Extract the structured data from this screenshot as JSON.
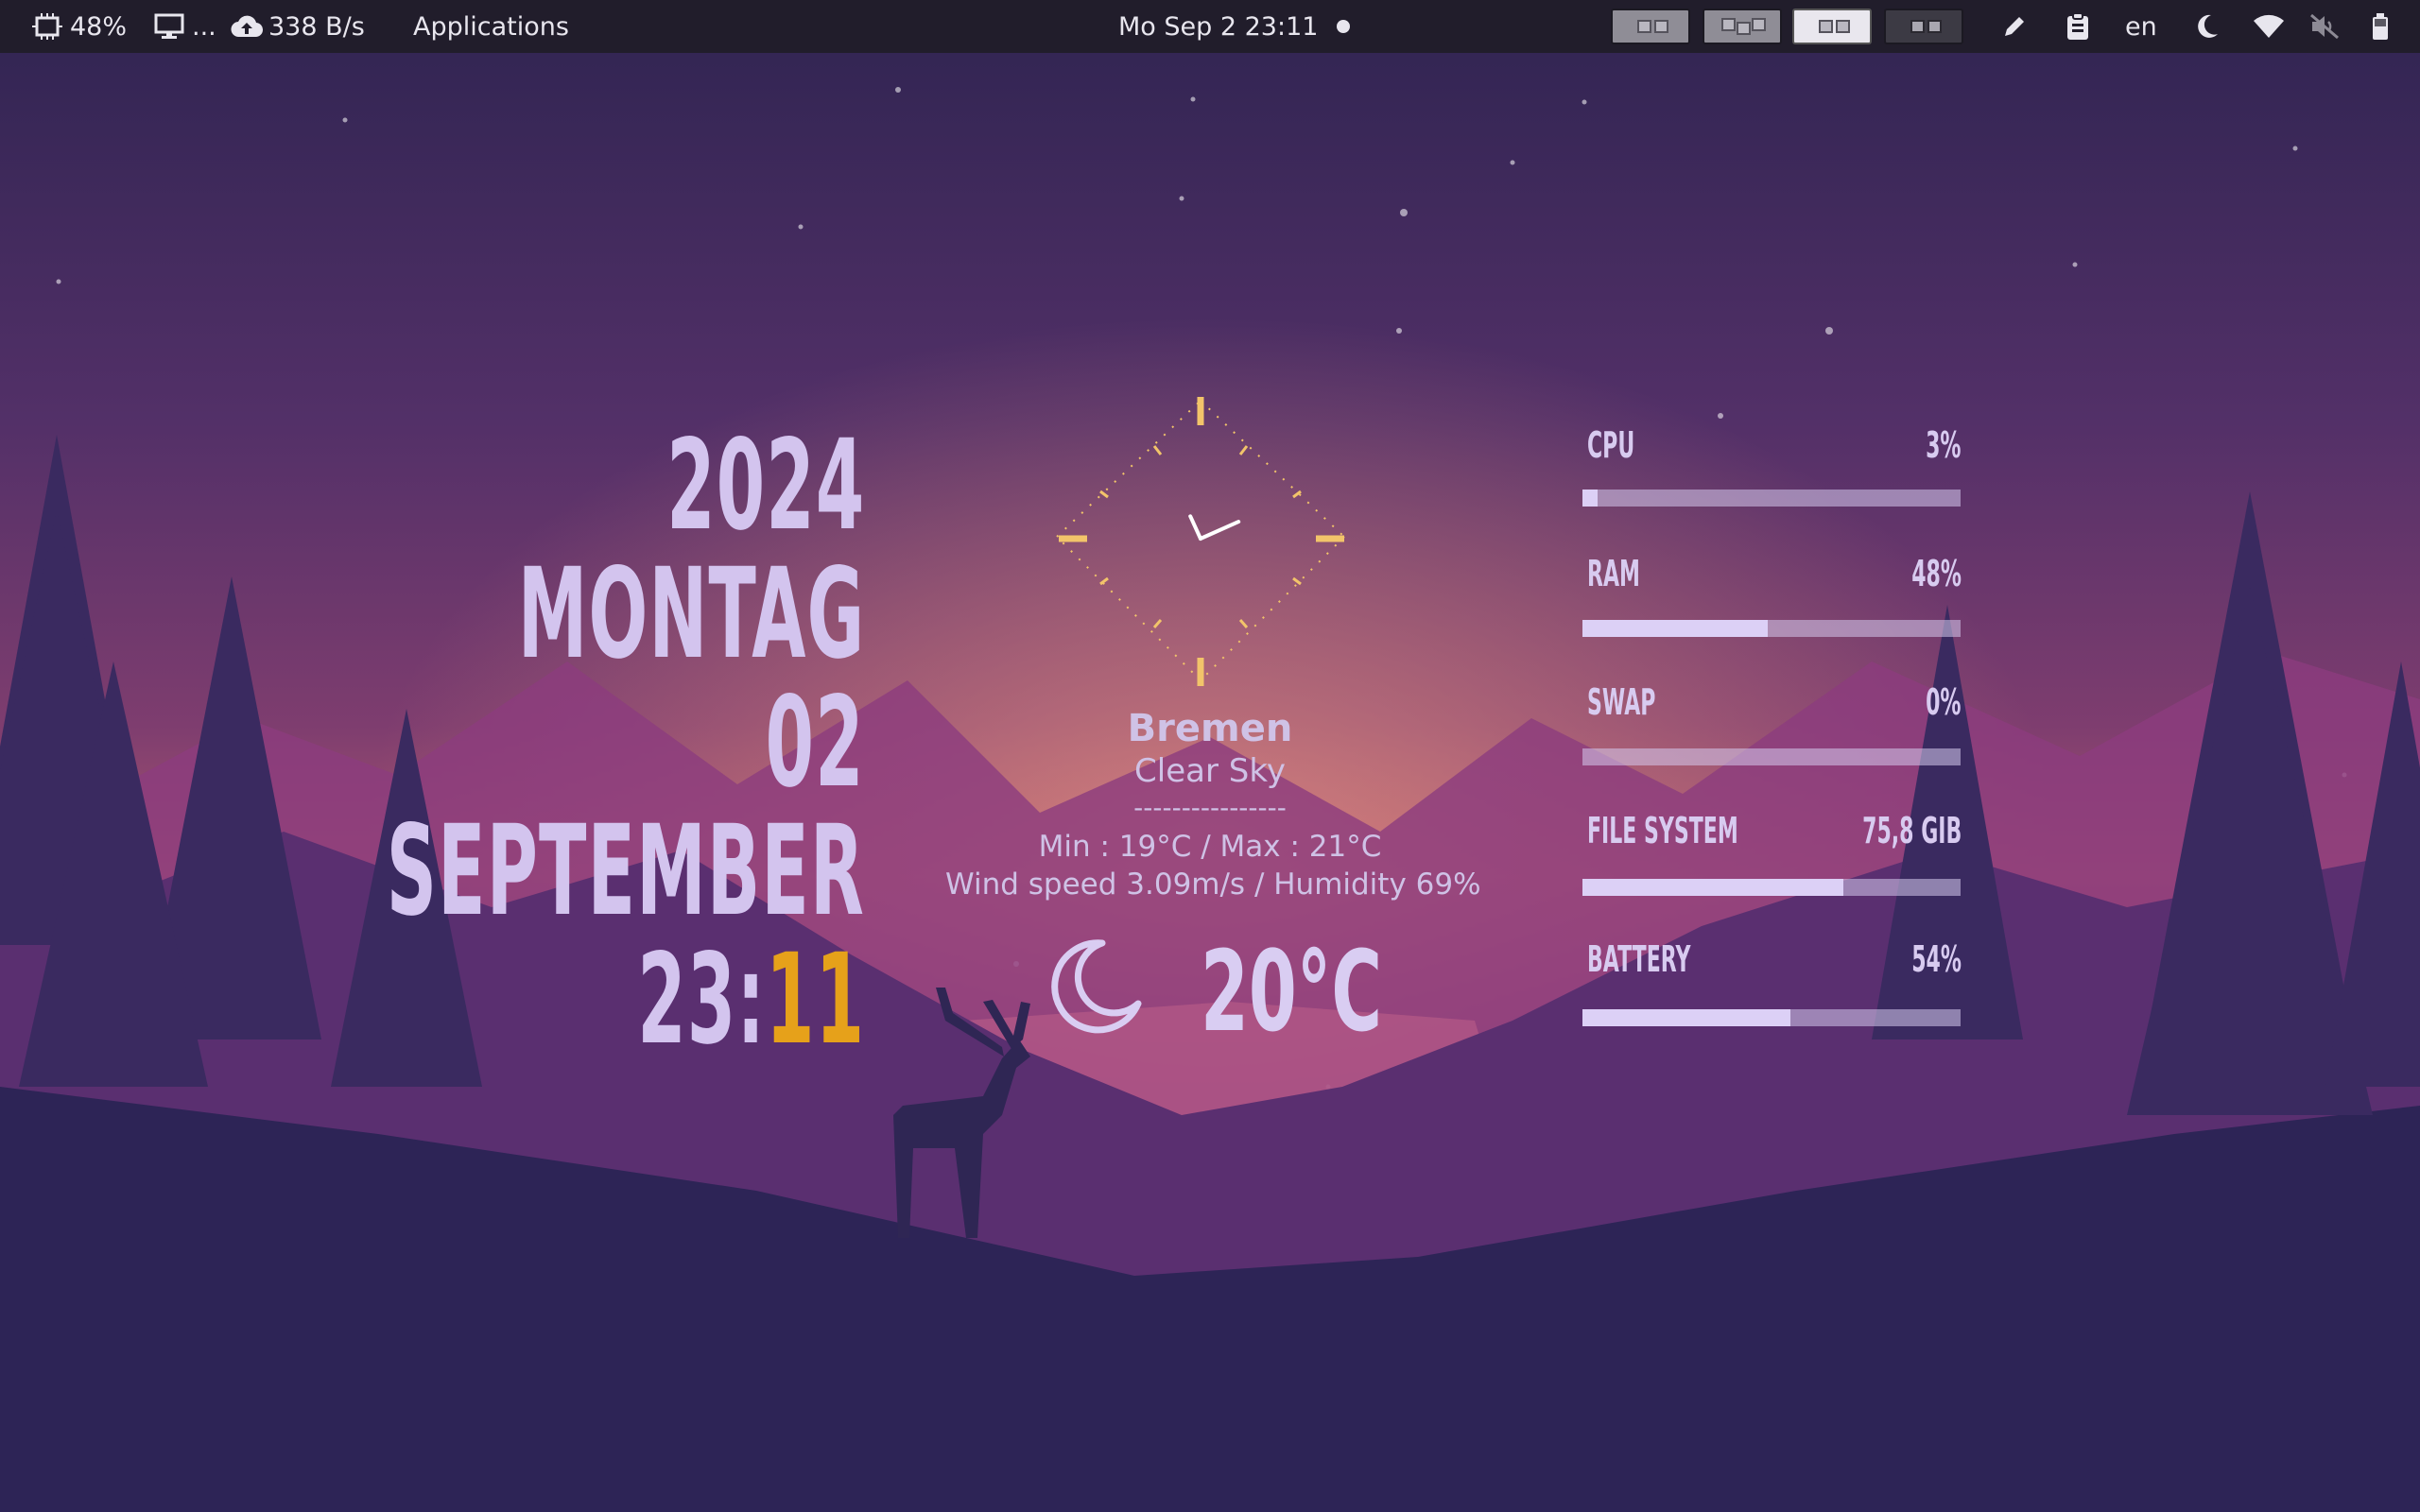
{
  "panel": {
    "cpu_text": "48%",
    "display_text": "...",
    "net_text": "338 B/s",
    "apps_label": "Applications",
    "datetime": "Mo Sep 2  23:11",
    "lang": "en",
    "workspaces": [
      "workspace-1",
      "workspace-2",
      "workspace-3",
      "workspace-4"
    ],
    "active_workspace": 3,
    "icons": [
      "cpu-icon",
      "monitor-icon",
      "cloud-upload-icon",
      "dot-icon",
      "pencil-icon",
      "clipboard-icon",
      "moon-icon",
      "wifi-icon",
      "volume-muted-icon",
      "battery-icon"
    ]
  },
  "date_widget": {
    "year": "2024",
    "weekday": "MONTAG",
    "day": "02",
    "month": "SEPTEMBER",
    "time_hours": "23:",
    "time_minutes": "11"
  },
  "weather": {
    "city": "Bremen",
    "condition": "Clear Sky",
    "separator": "----------------",
    "minmax": "Min : 19°C / Max : 21°C",
    "wind_humidity": "Wind speed 3.09m/s / Humidity 69%",
    "temperature": "20°C",
    "icon": "moon-icon"
  },
  "clock": {
    "hour": 23,
    "minute": 11
  },
  "stats": [
    {
      "label": "CPU",
      "value": "3%",
      "fraction": 0.04
    },
    {
      "label": "RAM",
      "value": "48%",
      "fraction": 0.49
    },
    {
      "label": "SWAP",
      "value": "0%",
      "fraction": 0.0
    },
    {
      "label": "FILE SYSTEM",
      "value": "75,8 GIB",
      "fraction": 0.69
    },
    {
      "label": "BATTERY",
      "value": "54%",
      "fraction": 0.55
    }
  ],
  "colors": {
    "panel_bg": "#211d2b",
    "text_lavender": "#d3c4ee",
    "accent": "#e6a11a",
    "clock_ticks": "#f2c46a"
  }
}
